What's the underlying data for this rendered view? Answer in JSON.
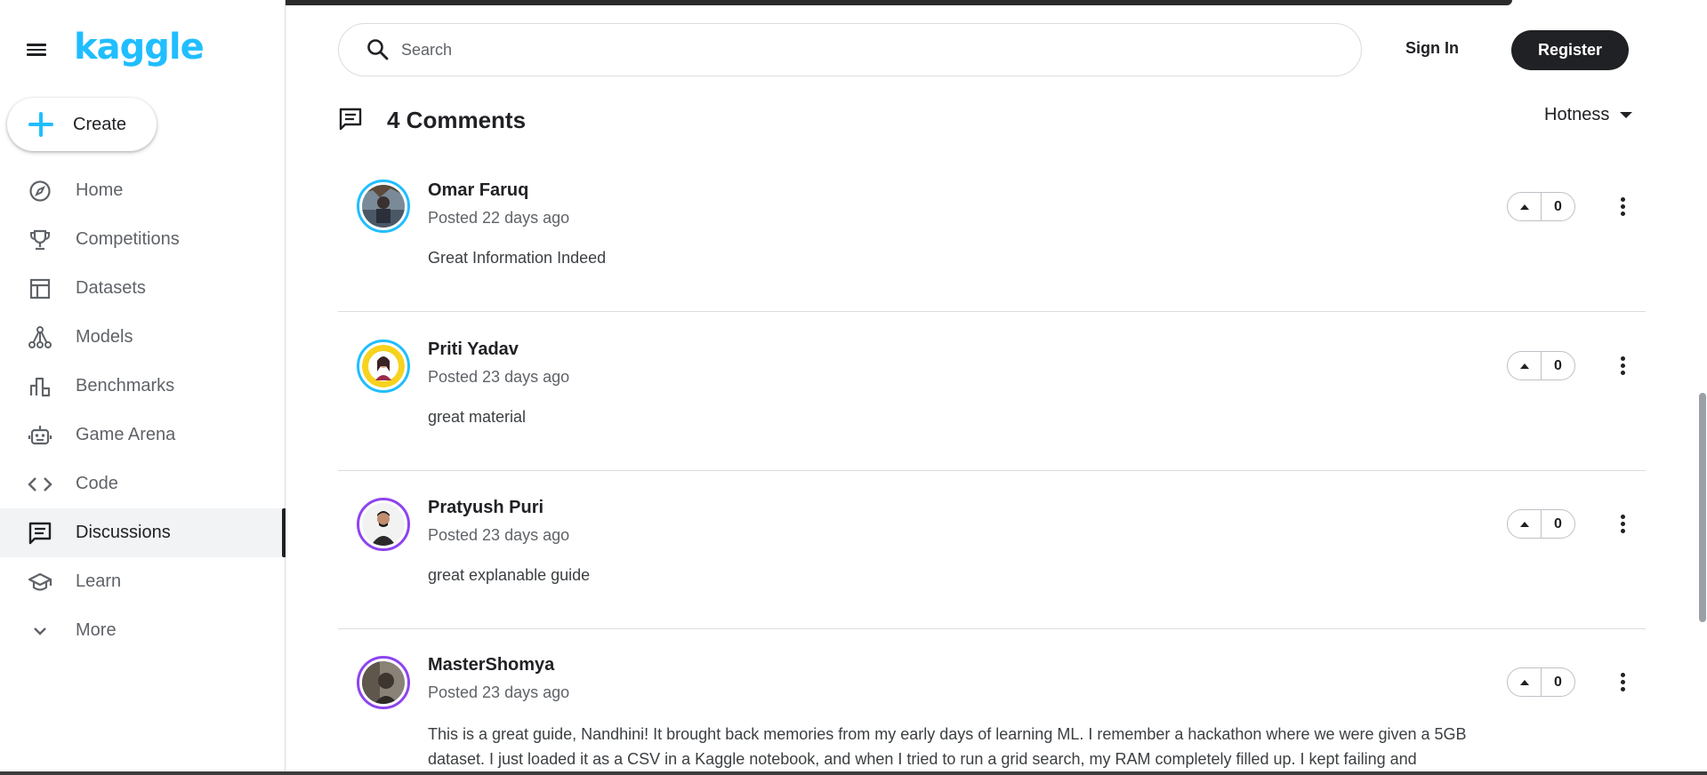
{
  "logo": "kaggle",
  "create_label": "Create",
  "nav": [
    {
      "label": "Home",
      "icon": "compass-icon"
    },
    {
      "label": "Competitions",
      "icon": "trophy-icon"
    },
    {
      "label": "Datasets",
      "icon": "table-icon"
    },
    {
      "label": "Models",
      "icon": "models-icon"
    },
    {
      "label": "Benchmarks",
      "icon": "bar-chart-icon"
    },
    {
      "label": "Game Arena",
      "icon": "robot-icon"
    },
    {
      "label": "Code",
      "icon": "code-icon"
    },
    {
      "label": "Discussions",
      "icon": "comments-icon",
      "active": true
    },
    {
      "label": "Learn",
      "icon": "school-icon"
    },
    {
      "label": "More",
      "icon": "chevron-down-icon"
    }
  ],
  "search": {
    "placeholder": "Search"
  },
  "header": {
    "signin": "Sign In",
    "register": "Register"
  },
  "comments": {
    "title": "4 Comments",
    "sort": "Hotness",
    "items": [
      {
        "author": "Omar Faruq",
        "posted": "Posted 22 days ago",
        "body": "Great Information Indeed",
        "votes": "0",
        "ring": "#20beff"
      },
      {
        "author": "Priti Yadav",
        "posted": "Posted 23 days ago",
        "body": "great material",
        "votes": "0",
        "ring": "#20beff"
      },
      {
        "author": "Pratyush Puri",
        "posted": "Posted 23 days ago",
        "body": "great explanable guide",
        "votes": "0",
        "ring": "#8e44ef"
      },
      {
        "author": "MasterShomya",
        "posted": "Posted 23 days ago",
        "body": "This is a great guide, Nandhini! It brought back memories from my early days of learning ML. I remember a hackathon where we were given a 5GB dataset. I just loaded it as a CSV in a Kaggle notebook, and when I tried to run a grid search, my RAM completely filled up. I kept failing and",
        "votes": "0",
        "ring": "#8e44ef"
      }
    ]
  },
  "colors": {
    "accent": "#20beff",
    "dark": "#202124",
    "purple": "#8e44ef"
  }
}
